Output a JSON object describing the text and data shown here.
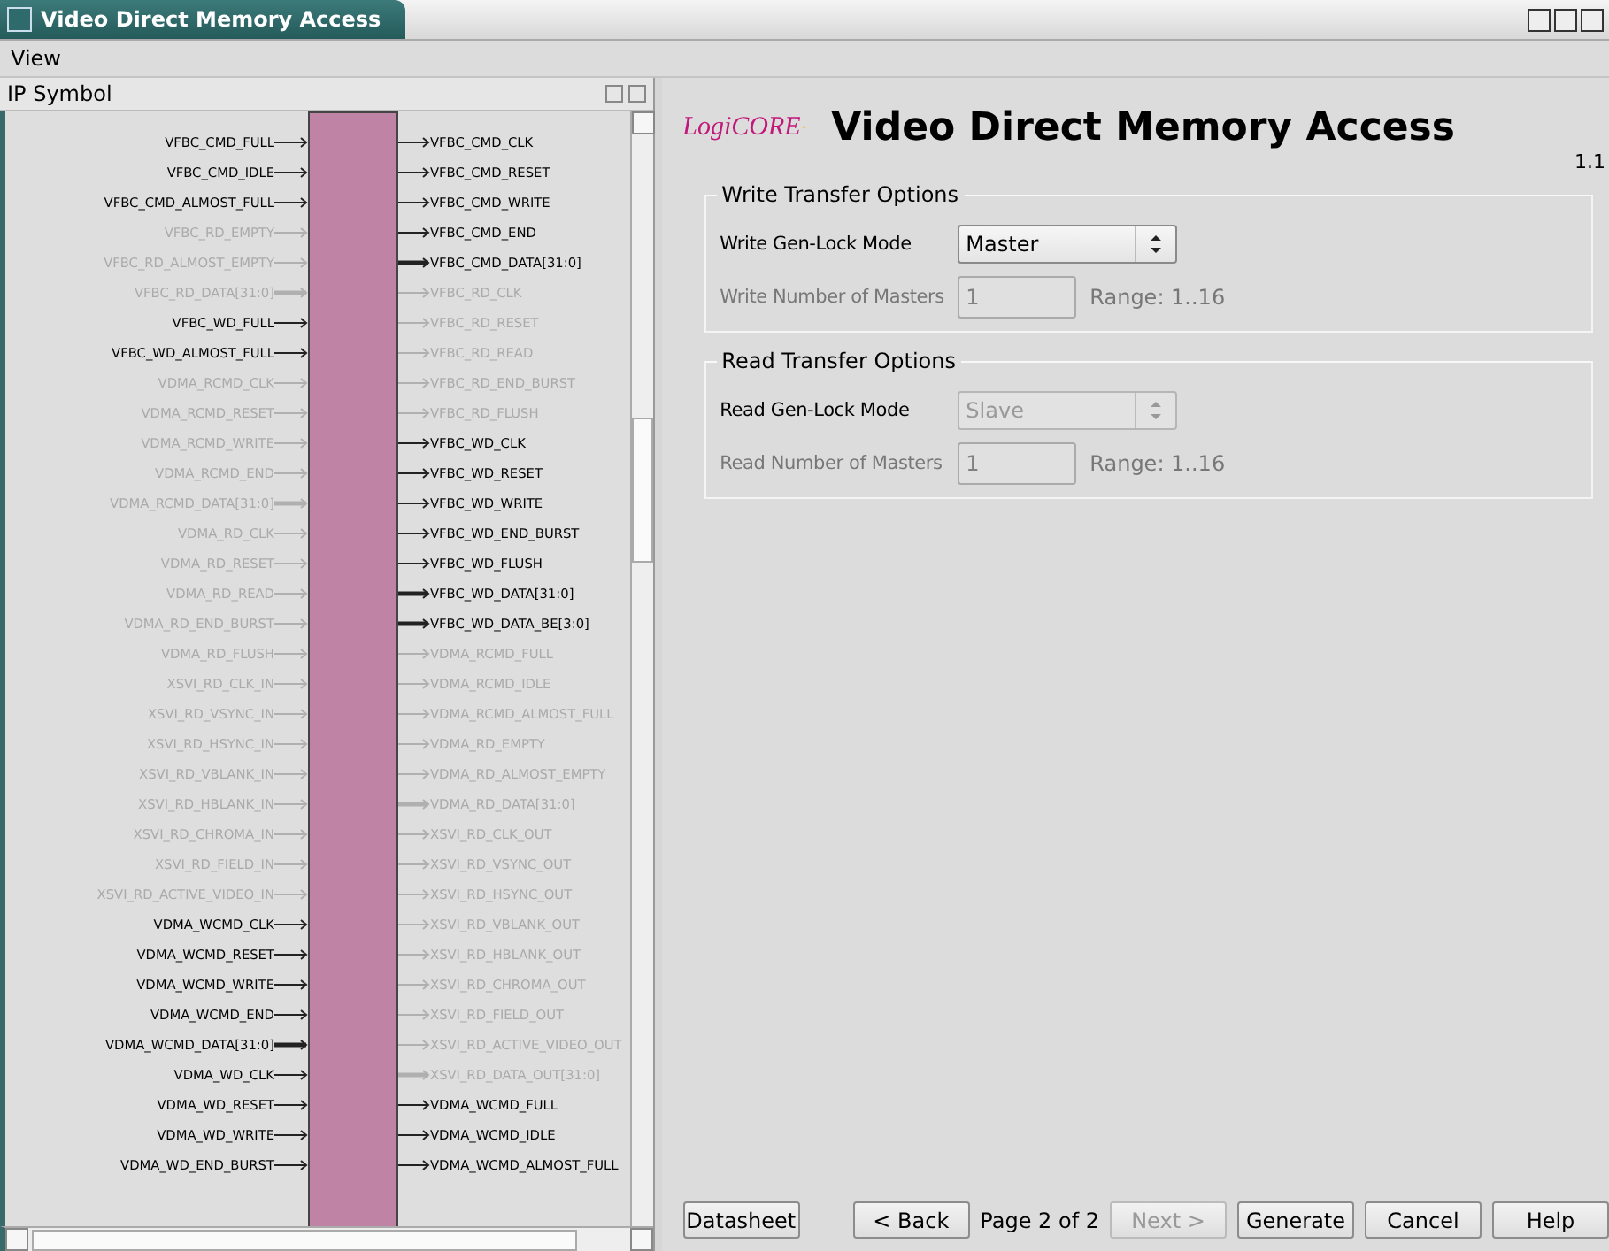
{
  "window": {
    "title": "Video Direct Memory Access"
  },
  "menu": [
    {
      "label": "View"
    }
  ],
  "ip_symbol": {
    "title": "IP Symbol",
    "inputs": [
      {
        "name": "VFBC_CMD_FULL",
        "enabled": true,
        "kind": "wire"
      },
      {
        "name": "VFBC_CMD_IDLE",
        "enabled": true,
        "kind": "wire"
      },
      {
        "name": "VFBC_CMD_ALMOST_FULL",
        "enabled": true,
        "kind": "wire"
      },
      {
        "name": "VFBC_RD_EMPTY",
        "enabled": false,
        "kind": "wire"
      },
      {
        "name": "VFBC_RD_ALMOST_EMPTY",
        "enabled": false,
        "kind": "wire"
      },
      {
        "name": "VFBC_RD_DATA[31:0]",
        "enabled": false,
        "kind": "bus"
      },
      {
        "name": "VFBC_WD_FULL",
        "enabled": true,
        "kind": "wire"
      },
      {
        "name": "VFBC_WD_ALMOST_FULL",
        "enabled": true,
        "kind": "wire"
      },
      {
        "name": "VDMA_RCMD_CLK",
        "enabled": false,
        "kind": "wire"
      },
      {
        "name": "VDMA_RCMD_RESET",
        "enabled": false,
        "kind": "wire"
      },
      {
        "name": "VDMA_RCMD_WRITE",
        "enabled": false,
        "kind": "wire"
      },
      {
        "name": "VDMA_RCMD_END",
        "enabled": false,
        "kind": "wire"
      },
      {
        "name": "VDMA_RCMD_DATA[31:0]",
        "enabled": false,
        "kind": "bus"
      },
      {
        "name": "VDMA_RD_CLK",
        "enabled": false,
        "kind": "wire"
      },
      {
        "name": "VDMA_RD_RESET",
        "enabled": false,
        "kind": "wire"
      },
      {
        "name": "VDMA_RD_READ",
        "enabled": false,
        "kind": "wire"
      },
      {
        "name": "VDMA_RD_END_BURST",
        "enabled": false,
        "kind": "wire"
      },
      {
        "name": "VDMA_RD_FLUSH",
        "enabled": false,
        "kind": "wire"
      },
      {
        "name": "XSVI_RD_CLK_IN",
        "enabled": false,
        "kind": "wire"
      },
      {
        "name": "XSVI_RD_VSYNC_IN",
        "enabled": false,
        "kind": "wire"
      },
      {
        "name": "XSVI_RD_HSYNC_IN",
        "enabled": false,
        "kind": "wire"
      },
      {
        "name": "XSVI_RD_VBLANK_IN",
        "enabled": false,
        "kind": "wire"
      },
      {
        "name": "XSVI_RD_HBLANK_IN",
        "enabled": false,
        "kind": "wire"
      },
      {
        "name": "XSVI_RD_CHROMA_IN",
        "enabled": false,
        "kind": "wire"
      },
      {
        "name": "XSVI_RD_FIELD_IN",
        "enabled": false,
        "kind": "wire"
      },
      {
        "name": "XSVI_RD_ACTIVE_VIDEO_IN",
        "enabled": false,
        "kind": "wire"
      },
      {
        "name": "VDMA_WCMD_CLK",
        "enabled": true,
        "kind": "wire"
      },
      {
        "name": "VDMA_WCMD_RESET",
        "enabled": true,
        "kind": "wire"
      },
      {
        "name": "VDMA_WCMD_WRITE",
        "enabled": true,
        "kind": "wire"
      },
      {
        "name": "VDMA_WCMD_END",
        "enabled": true,
        "kind": "wire"
      },
      {
        "name": "VDMA_WCMD_DATA[31:0]",
        "enabled": true,
        "kind": "bus"
      },
      {
        "name": "VDMA_WD_CLK",
        "enabled": true,
        "kind": "wire"
      },
      {
        "name": "VDMA_WD_RESET",
        "enabled": true,
        "kind": "wire"
      },
      {
        "name": "VDMA_WD_WRITE",
        "enabled": true,
        "kind": "wire"
      },
      {
        "name": "VDMA_WD_END_BURST",
        "enabled": true,
        "kind": "wire"
      }
    ],
    "outputs": [
      {
        "name": "VFBC_CMD_CLK",
        "enabled": true,
        "kind": "wire"
      },
      {
        "name": "VFBC_CMD_RESET",
        "enabled": true,
        "kind": "wire"
      },
      {
        "name": "VFBC_CMD_WRITE",
        "enabled": true,
        "kind": "wire"
      },
      {
        "name": "VFBC_CMD_END",
        "enabled": true,
        "kind": "wire"
      },
      {
        "name": "VFBC_CMD_DATA[31:0]",
        "enabled": true,
        "kind": "bus"
      },
      {
        "name": "VFBC_RD_CLK",
        "enabled": false,
        "kind": "wire"
      },
      {
        "name": "VFBC_RD_RESET",
        "enabled": false,
        "kind": "wire"
      },
      {
        "name": "VFBC_RD_READ",
        "enabled": false,
        "kind": "wire"
      },
      {
        "name": "VFBC_RD_END_BURST",
        "enabled": false,
        "kind": "wire"
      },
      {
        "name": "VFBC_RD_FLUSH",
        "enabled": false,
        "kind": "wire"
      },
      {
        "name": "VFBC_WD_CLK",
        "enabled": true,
        "kind": "wire"
      },
      {
        "name": "VFBC_WD_RESET",
        "enabled": true,
        "kind": "wire"
      },
      {
        "name": "VFBC_WD_WRITE",
        "enabled": true,
        "kind": "wire"
      },
      {
        "name": "VFBC_WD_END_BURST",
        "enabled": true,
        "kind": "wire"
      },
      {
        "name": "VFBC_WD_FLUSH",
        "enabled": true,
        "kind": "wire"
      },
      {
        "name": "VFBC_WD_DATA[31:0]",
        "enabled": true,
        "kind": "bus"
      },
      {
        "name": "VFBC_WD_DATA_BE[3:0]",
        "enabled": true,
        "kind": "bus"
      },
      {
        "name": "VDMA_RCMD_FULL",
        "enabled": false,
        "kind": "wire"
      },
      {
        "name": "VDMA_RCMD_IDLE",
        "enabled": false,
        "kind": "wire"
      },
      {
        "name": "VDMA_RCMD_ALMOST_FULL",
        "enabled": false,
        "kind": "wire"
      },
      {
        "name": "VDMA_RD_EMPTY",
        "enabled": false,
        "kind": "wire"
      },
      {
        "name": "VDMA_RD_ALMOST_EMPTY",
        "enabled": false,
        "kind": "wire"
      },
      {
        "name": "VDMA_RD_DATA[31:0]",
        "enabled": false,
        "kind": "bus"
      },
      {
        "name": "XSVI_RD_CLK_OUT",
        "enabled": false,
        "kind": "wire"
      },
      {
        "name": "XSVI_RD_VSYNC_OUT",
        "enabled": false,
        "kind": "wire"
      },
      {
        "name": "XSVI_RD_HSYNC_OUT",
        "enabled": false,
        "kind": "wire"
      },
      {
        "name": "XSVI_RD_VBLANK_OUT",
        "enabled": false,
        "kind": "wire"
      },
      {
        "name": "XSVI_RD_HBLANK_OUT",
        "enabled": false,
        "kind": "wire"
      },
      {
        "name": "XSVI_RD_CHROMA_OUT",
        "enabled": false,
        "kind": "wire"
      },
      {
        "name": "XSVI_RD_FIELD_OUT",
        "enabled": false,
        "kind": "wire"
      },
      {
        "name": "XSVI_RD_ACTIVE_VIDEO_OUT",
        "enabled": false,
        "kind": "wire"
      },
      {
        "name": "XSVI_RD_DATA_OUT[31:0]",
        "enabled": false,
        "kind": "bus"
      },
      {
        "name": "VDMA_WCMD_FULL",
        "enabled": true,
        "kind": "wire"
      },
      {
        "name": "VDMA_WCMD_IDLE",
        "enabled": true,
        "kind": "wire"
      },
      {
        "name": "VDMA_WCMD_ALMOST_FULL",
        "enabled": true,
        "kind": "wire"
      }
    ]
  },
  "header": {
    "logo": "LogiCORE",
    "title": "Video Direct Memory Access",
    "version": "1.1"
  },
  "groups": [
    {
      "title": "Write Transfer Options",
      "mode": {
        "label": "Write Gen-Lock Mode",
        "value": "Master",
        "disabled": false
      },
      "masters": {
        "label": "Write Number of Masters",
        "value": "1",
        "range": "Range: 1..16",
        "disabled": true
      }
    },
    {
      "title": "Read Transfer Options",
      "mode": {
        "label": "Read Gen-Lock Mode",
        "value": "Slave",
        "disabled": true
      },
      "masters": {
        "label": "Read Number of Masters",
        "value": "1",
        "range": "Range: 1..16",
        "disabled": true
      }
    }
  ],
  "footer": {
    "left_buttons": [
      {
        "label": "Datasheet",
        "disabled": false
      }
    ],
    "back_button": {
      "label": "< Back",
      "disabled": false
    },
    "page": "Page 2 of 2",
    "right_buttons": [
      {
        "label": "Next >",
        "disabled": true
      },
      {
        "label": "Generate",
        "disabled": false
      },
      {
        "label": "Cancel",
        "disabled": false
      },
      {
        "label": "Help",
        "disabled": false
      }
    ]
  }
}
